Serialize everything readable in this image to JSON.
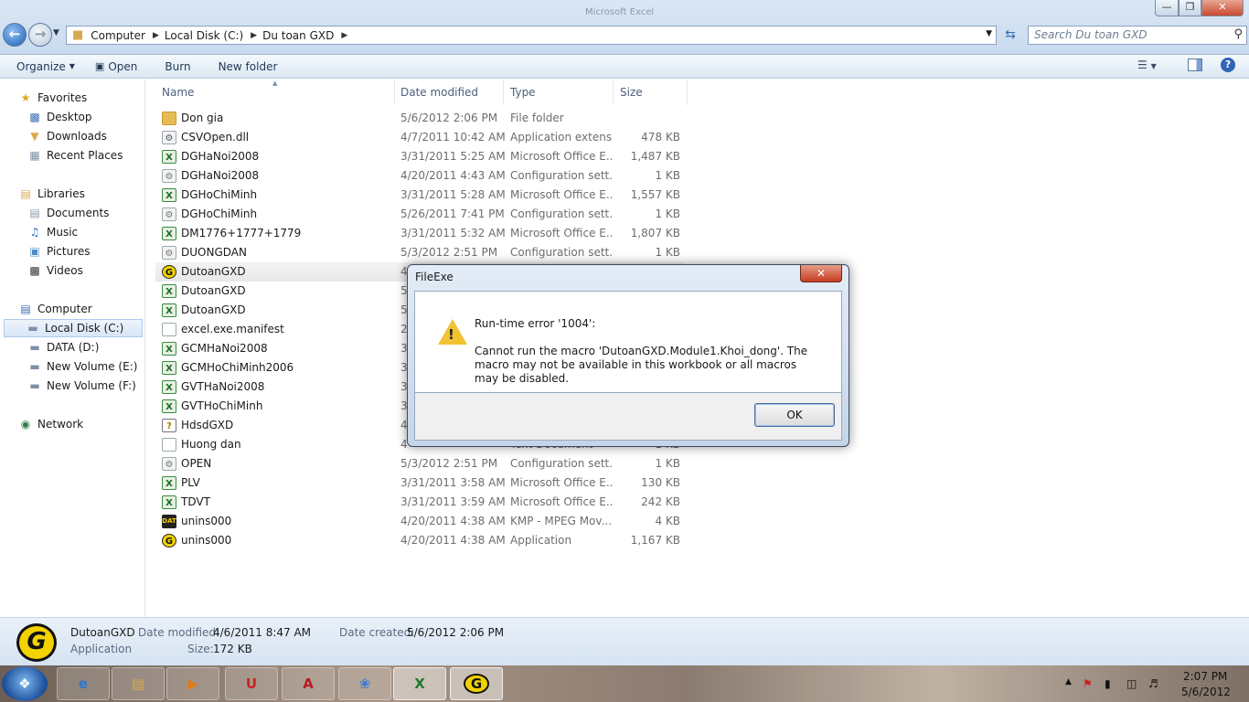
{
  "window": {
    "bg_title": "Microsoft Excel",
    "min_glyph": "—",
    "max_glyph": "❐",
    "close_glyph": "✕"
  },
  "address": {
    "crumbs": [
      "Computer",
      "Local Disk (C:)",
      "Du toan GXD"
    ],
    "search_placeholder": "Search Du toan GXD"
  },
  "toolbar": {
    "organize": "Organize",
    "open": "Open",
    "burn": "Burn",
    "new_folder": "New folder"
  },
  "nav": {
    "favorites": "Favorites",
    "desktop": "Desktop",
    "downloads": "Downloads",
    "recent_places": "Recent Places",
    "libraries": "Libraries",
    "documents": "Documents",
    "music": "Music",
    "pictures": "Pictures",
    "videos": "Videos",
    "computer": "Computer",
    "local_disk": "Local Disk (C:)",
    "data_d": "DATA (D:)",
    "new_volume_e": "New Volume (E:)",
    "new_volume_f": "New Volume (F:)",
    "network": "Network"
  },
  "columns": {
    "name": "Name",
    "date": "Date modified",
    "type": "Type",
    "size": "Size"
  },
  "files": [
    {
      "name": "Don gia",
      "date": "5/6/2012 2:06 PM",
      "type": "File folder",
      "size": "",
      "icon": "folder-icon"
    },
    {
      "name": "CSVOpen.dll",
      "date": "4/7/2011 10:42 AM",
      "type": "Application extens...",
      "size": "478 KB",
      "icon": "dll-file-icon"
    },
    {
      "name": "DGHaNoi2008",
      "date": "3/31/2011 5:25 AM",
      "type": "Microsoft Office E...",
      "size": "1,487 KB",
      "icon": "excel-file-icon"
    },
    {
      "name": "DGHaNoi2008",
      "date": "4/20/2011 4:43 AM",
      "type": "Configuration sett...",
      "size": "1 KB",
      "icon": "config-file-icon"
    },
    {
      "name": "DGHoChiMinh",
      "date": "3/31/2011 5:28 AM",
      "type": "Microsoft Office E...",
      "size": "1,557 KB",
      "icon": "excel-file-icon"
    },
    {
      "name": "DGHoChiMinh",
      "date": "5/26/2011 7:41 PM",
      "type": "Configuration sett...",
      "size": "1 KB",
      "icon": "config-file-icon"
    },
    {
      "name": "DM1776+1777+1779",
      "date": "3/31/2011 5:32 AM",
      "type": "Microsoft Office E...",
      "size": "1,807 KB",
      "icon": "excel-file-icon"
    },
    {
      "name": "DUONGDAN",
      "date": "5/3/2012 2:51 PM",
      "type": "Configuration sett...",
      "size": "1 KB",
      "icon": "config-file-icon"
    },
    {
      "name": "DutoanGXD",
      "date": "4",
      "type": "",
      "size": "",
      "icon": "gxd-app-icon"
    },
    {
      "name": "DutoanGXD",
      "date": "5",
      "type": "",
      "size": "",
      "icon": "excel-file-icon"
    },
    {
      "name": "DutoanGXD",
      "date": "5",
      "type": "",
      "size": "",
      "icon": "excel-file-icon"
    },
    {
      "name": "excel.exe.manifest",
      "date": "2",
      "type": "",
      "size": "",
      "icon": "text-file-icon"
    },
    {
      "name": "GCMHaNoi2008",
      "date": "3",
      "type": "",
      "size": "",
      "icon": "excel-file-icon"
    },
    {
      "name": "GCMHoChiMinh2006",
      "date": "3",
      "type": "",
      "size": "",
      "icon": "excel-file-icon"
    },
    {
      "name": "GVTHaNoi2008",
      "date": "3",
      "type": "",
      "size": "",
      "icon": "excel-file-icon"
    },
    {
      "name": "GVTHoChiMinh",
      "date": "3",
      "type": "",
      "size": "",
      "icon": "excel-file-icon"
    },
    {
      "name": "HdsdGXD",
      "date": "4",
      "type": "",
      "size": "",
      "icon": "help-file-icon"
    },
    {
      "name": "Huong dan",
      "date": "4",
      "type": "Text Document",
      "size": "1 KB",
      "icon": "text-file-icon"
    },
    {
      "name": "OPEN",
      "date": "5/3/2012 2:51 PM",
      "type": "Configuration sett...",
      "size": "1 KB",
      "icon": "config-file-icon"
    },
    {
      "name": "PLV",
      "date": "3/31/2011 3:58 AM",
      "type": "Microsoft Office E...",
      "size": "130 KB",
      "icon": "excel-file-icon"
    },
    {
      "name": "TDVT",
      "date": "3/31/2011 3:59 AM",
      "type": "Microsoft Office E...",
      "size": "242 KB",
      "icon": "excel-file-icon"
    },
    {
      "name": "unins000",
      "date": "4/20/2011 4:38 AM",
      "type": "KMP - MPEG Mov...",
      "size": "4 KB",
      "icon": "dat-file-icon"
    },
    {
      "name": "unins000",
      "date": "4/20/2011 4:38 AM",
      "type": "Application",
      "size": "1,167 KB",
      "icon": "gxd-app-icon"
    }
  ],
  "details": {
    "name": "DutoanGXD",
    "type": "Application",
    "date_modified_label": "Date modified:",
    "date_modified": "4/6/2011 8:47 AM",
    "date_created_label": "Date created:",
    "date_created": "5/6/2012 2:06 PM",
    "size_label": "Size:",
    "size": "172 KB"
  },
  "dialog": {
    "title": "FileExe",
    "close_glyph": "✕",
    "heading": "Run-time error '1004':",
    "message": "Cannot run the macro 'DutoanGXD.Module1.Khoi_dong'. The macro may not be available in this workbook or all macros may be disabled.",
    "ok": "OK"
  },
  "taskbar": {
    "items": [
      "internet-explorer",
      "windows-explorer",
      "media-player",
      "unikey",
      "adobe-reader",
      "paint",
      "excel",
      "dutoan-gxd"
    ],
    "time": "2:07 PM",
    "date": "5/6/2012"
  },
  "colors": {
    "accent": "#3a6db5",
    "gxd_yellow": "#f2d200",
    "excel_green": "#1e6b23",
    "close_red": "#c63c22"
  }
}
